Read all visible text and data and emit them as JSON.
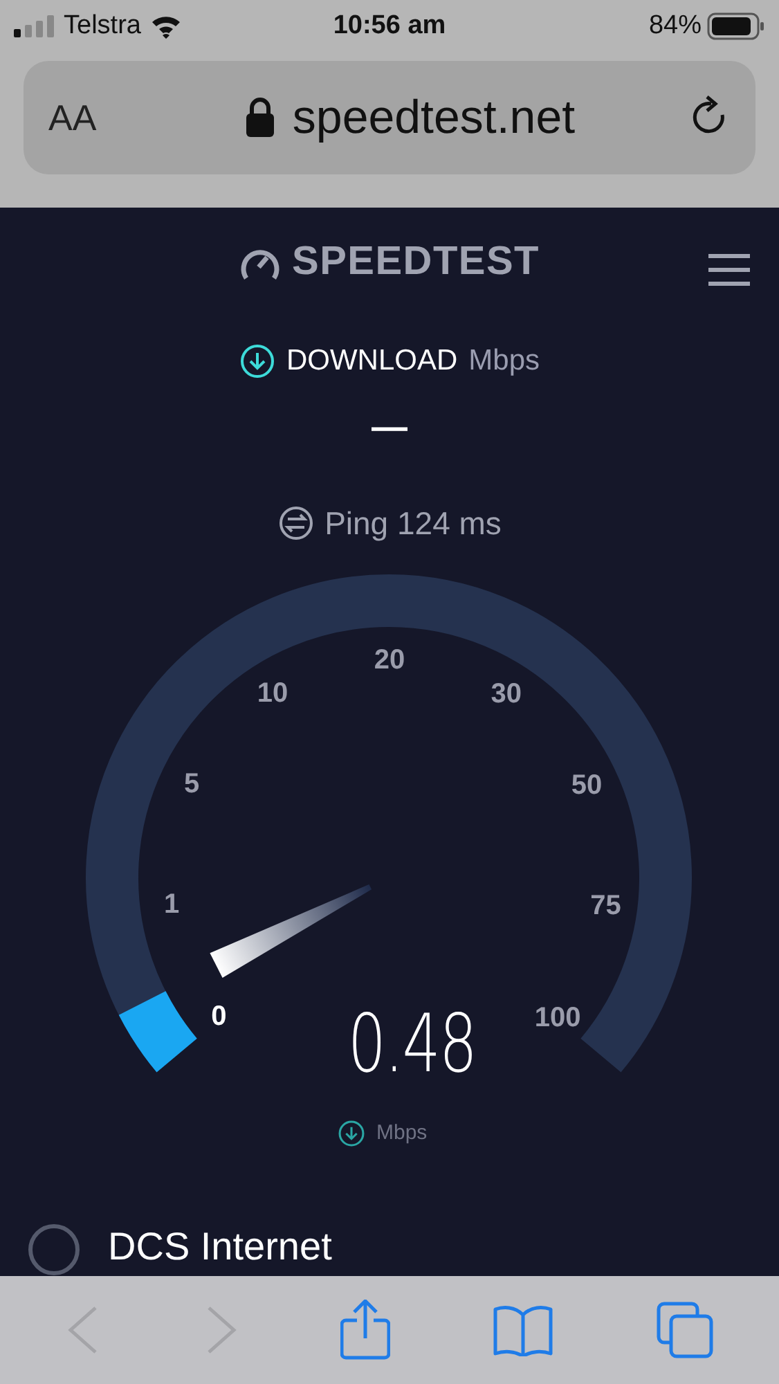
{
  "status_bar": {
    "carrier": "Telstra",
    "time": "10:56 am",
    "battery": "84%"
  },
  "address_bar": {
    "text_size": "AA",
    "url": "speedtest.net"
  },
  "header": {
    "logo": "SPEEDTEST"
  },
  "download": {
    "label": "DOWNLOAD",
    "unit": "Mbps",
    "result": "—"
  },
  "ping": {
    "label": "Ping 124 ms"
  },
  "gauge": {
    "ticks": [
      "0",
      "1",
      "5",
      "10",
      "20",
      "30",
      "50",
      "75",
      "100"
    ],
    "reading": "0.48",
    "unit": "Mbps"
  },
  "provider": {
    "name": "DCS Internet"
  },
  "toolbar": {
    "back_disabled": true,
    "forward_disabled": true
  }
}
